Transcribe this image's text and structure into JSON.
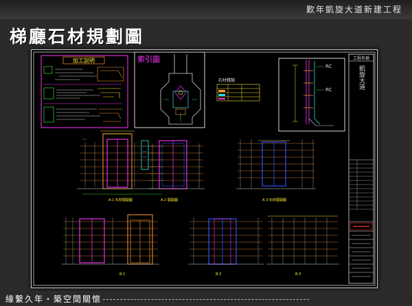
{
  "header": {
    "project_name": "歎年凱旋大道新建工程",
    "page_title": "梯廳石材規劃圖"
  },
  "drawing": {
    "notes_title": "加工說明",
    "index_title": "索引圖",
    "legend_title": "石材種類",
    "section_label_1": "RC",
    "section_label_2": "RC",
    "title_block_header": "工程名稱",
    "title_block_project": "凱旋大道",
    "elevation_captions": [
      "A-1 石材展開圖",
      "A-2 展開圖",
      "A-3 石材展開圖",
      "B-1",
      "B-2",
      "B-3"
    ]
  },
  "footer": {
    "slogan": "緣繫久年・築空間關懷"
  },
  "colors": {
    "background": "#2b2b2b",
    "sheet": "#000000",
    "cad_white": "#d8d8d8",
    "cad_magenta": "#ff33ff",
    "cad_blue": "#3050ff",
    "cad_orange": "#ff9a33",
    "cad_yellow": "#ffea33",
    "cad_cyan": "#33e0e0",
    "cad_green": "#33dd33"
  }
}
